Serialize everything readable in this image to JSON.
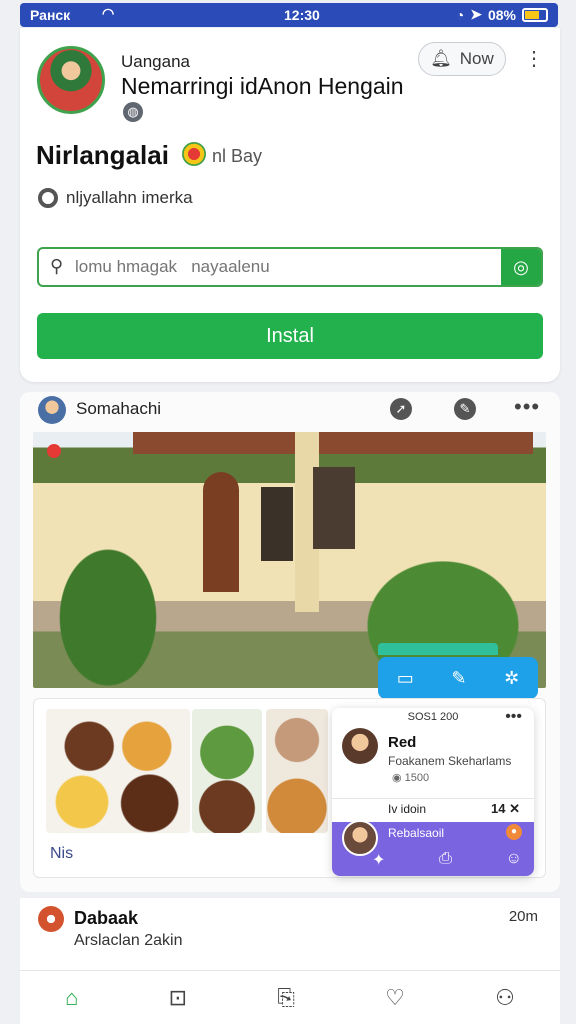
{
  "status_bar": {
    "carrier": "Ранск",
    "time": "12:30",
    "battery": "08%",
    "colors": {
      "background": "#2b4bb8"
    }
  },
  "profile": {
    "subtitle_name": "Uangana",
    "display_name": "Nemarringi idAnon  Hengain",
    "now_button": "Now",
    "page_title": "Nirlangalai",
    "badge_text": "nl Bay",
    "location": "nljyallahn imerka",
    "search": {
      "placeholder": "lomu hmagak   nayaalenu"
    },
    "install_button": "Instal",
    "colors": {
      "accent": "#24a744"
    }
  },
  "post": {
    "author": "Somahachi",
    "gallery_caption": "Nis",
    "popup": {
      "header": "SOS1 200",
      "name": "Red",
      "subtitle": "Foakanem Skeharlams",
      "meta": "1500",
      "row_left": "Iv idoin",
      "row_right": "14",
      "bar_label": "Rebalsaoil",
      "colors": {
        "bar": "#7b64e0"
      }
    }
  },
  "comment": {
    "author": "Dabaak",
    "text": "Arslaclan 2akin",
    "time": "20m"
  }
}
